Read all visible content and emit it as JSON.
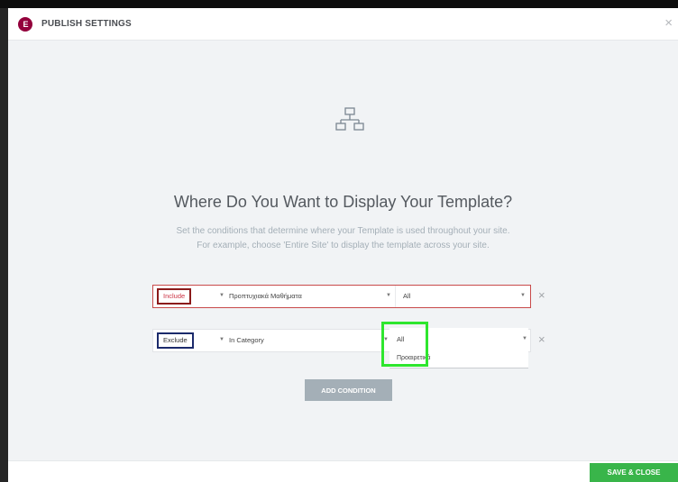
{
  "header": {
    "logo_glyph": "E",
    "title": "PUBLISH SETTINGS",
    "close_icon": "×"
  },
  "main": {
    "icon": "hierarchy-icon",
    "headline": "Where Do You Want to Display Your Template?",
    "subtitle_line1": "Set the conditions that determine where your Template is used throughout your site.",
    "subtitle_line2": "For example, choose 'Entire Site' to display the template across your site."
  },
  "conditions": [
    {
      "type": "Include",
      "field1": "Προπτυχιακά Μαθήματα",
      "field2": "All",
      "remove": "×"
    },
    {
      "type": "Exclude",
      "field1": "In Category",
      "field2": "All",
      "dropdown_option": "Προαιρετικά",
      "remove": "×"
    }
  ],
  "add_condition_label": "ADD CONDITION",
  "footer": {
    "save_label": "SAVE & CLOSE"
  },
  "colors": {
    "brand": "#93003c",
    "save": "#39b54a",
    "highlight": "#2ee62e",
    "include_border": "#8b1a1a",
    "exclude_border": "#1b2a6b"
  }
}
